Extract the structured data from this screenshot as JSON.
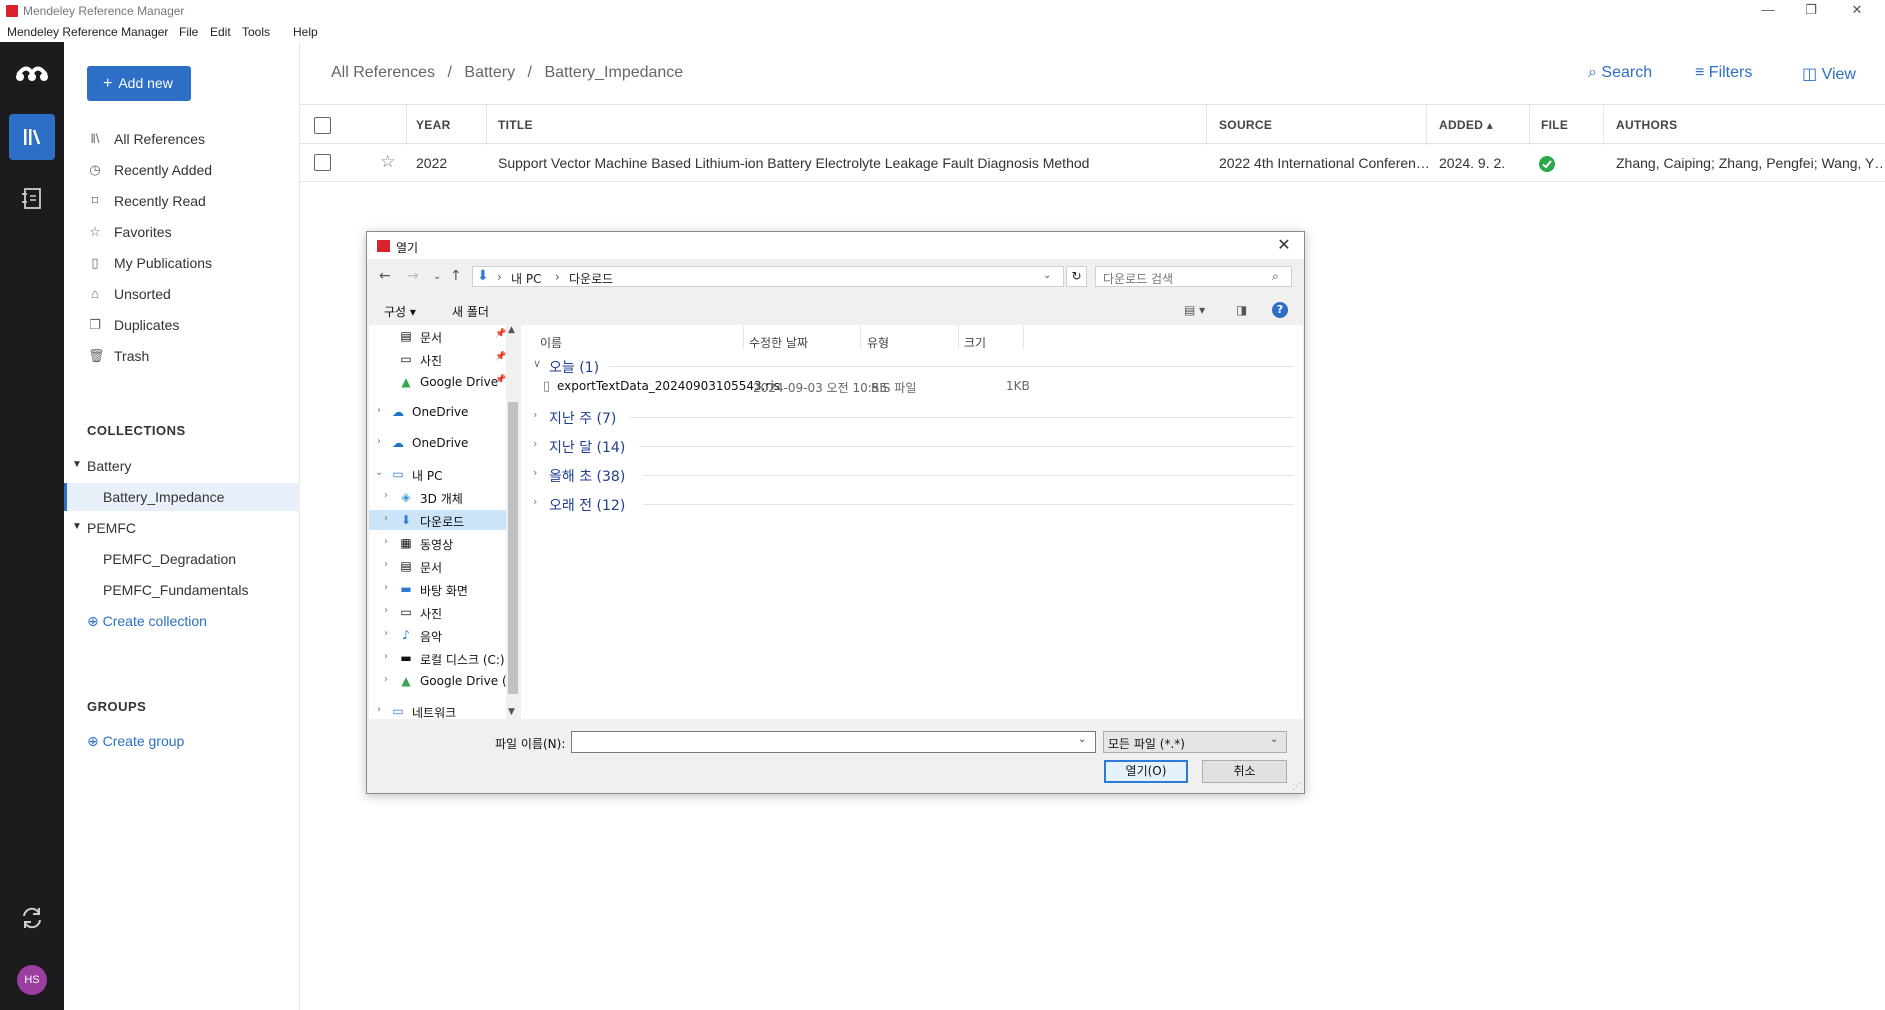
{
  "window": {
    "title": "Mendeley Reference Manager",
    "menu": [
      "Mendeley Reference Manager",
      "File",
      "Edit",
      "Tools",
      "Help"
    ],
    "controls": {
      "minimize": "—",
      "restore": "❐",
      "close": "✕"
    }
  },
  "rail": {
    "avatar_initials": "HS",
    "icons": [
      "mendeley-logo-icon",
      "library-icon",
      "notebook-icon",
      "sync-icon"
    ]
  },
  "sidebar": {
    "add_new_label": "Add new",
    "nav_items": [
      {
        "label": "All References",
        "icon": "library-icon"
      },
      {
        "label": "Recently Added",
        "icon": "clock-icon"
      },
      {
        "label": "Recently Read",
        "icon": "bookmark-icon"
      },
      {
        "label": "Favorites",
        "icon": "star-icon"
      },
      {
        "label": "My Publications",
        "icon": "document-icon"
      },
      {
        "label": "Unsorted",
        "icon": "inbox-icon"
      },
      {
        "label": "Duplicates",
        "icon": "duplicate-icon"
      },
      {
        "label": "Trash",
        "icon": "trash-icon"
      }
    ],
    "collections_heading": "COLLECTIONS",
    "collections": [
      {
        "label": "Battery",
        "expanded": true,
        "level": 0
      },
      {
        "label": "Battery_Impedance",
        "level": 1,
        "selected": true
      },
      {
        "label": "PEMFC",
        "expanded": true,
        "level": 0
      },
      {
        "label": "PEMFC_Degradation",
        "level": 1
      },
      {
        "label": "PEMFC_Fundamentals",
        "level": 1
      }
    ],
    "create_collection_label": "Create collection",
    "groups_heading": "GROUPS",
    "create_group_label": "Create group"
  },
  "main": {
    "breadcrumb": [
      "All References",
      "Battery",
      "Battery_Impedance"
    ],
    "breadcrumb_sep": "/",
    "actions": {
      "search": "Search",
      "filters": "Filters",
      "view": "View"
    },
    "columns": [
      "YEAR",
      "TITLE",
      "SOURCE",
      "ADDED ▴",
      "FILE",
      "AUTHORS"
    ],
    "rows": [
      {
        "year": "2022",
        "title": "Support Vector Machine Based Lithium-ion Battery Electrolyte Leakage Fault Diagnosis Method",
        "source": "2022 4th International Conferen…",
        "added": "2024. 9. 2.",
        "file_status": "available",
        "authors": "Zhang, Caiping; Zhang, Pengfei; Wang, Y…"
      }
    ]
  },
  "dialog": {
    "title": "열기",
    "path": [
      "내 PC",
      "다운로드"
    ],
    "search_placeholder": "다운로드 검색",
    "organize_label": "구성 ▾",
    "new_folder_label": "새 폴더",
    "tree": [
      {
        "label": "문서",
        "icon": "document-icon",
        "pinned": true,
        "indent": 1
      },
      {
        "label": "사진",
        "icon": "pictures-icon",
        "pinned": true,
        "indent": 1
      },
      {
        "label": "Google Drive",
        "icon": "google-drive-icon",
        "pinned": true,
        "indent": 1
      },
      {
        "label": "OneDrive",
        "icon": "onedrive-icon",
        "chevron": "›",
        "indent": 0
      },
      {
        "label": "OneDrive",
        "icon": "onedrive-icon",
        "chevron": "›",
        "indent": 0
      },
      {
        "label": "내 PC",
        "icon": "computer-icon",
        "chevron": "⌄",
        "indent": 0
      },
      {
        "label": "3D 개체",
        "icon": "cube-icon",
        "chevron": "›",
        "indent": 1
      },
      {
        "label": "다운로드",
        "icon": "download-icon",
        "chevron": "›",
        "indent": 1,
        "selected": true
      },
      {
        "label": "동영상",
        "icon": "video-icon",
        "chevron": "›",
        "indent": 1
      },
      {
        "label": "문서",
        "icon": "document-icon",
        "chevron": "›",
        "indent": 1
      },
      {
        "label": "바탕 화면",
        "icon": "desktop-icon",
        "chevron": "›",
        "indent": 1
      },
      {
        "label": "사진",
        "icon": "pictures-icon",
        "chevron": "›",
        "indent": 1
      },
      {
        "label": "음악",
        "icon": "music-icon",
        "chevron": "›",
        "indent": 1
      },
      {
        "label": "로컬 디스크 (C:)",
        "icon": "drive-icon",
        "chevron": "›",
        "indent": 1
      },
      {
        "label": "Google Drive (G",
        "icon": "google-drive-icon",
        "chevron": "›",
        "indent": 1
      },
      {
        "label": "네트워크",
        "icon": "network-icon",
        "chevron": "›",
        "indent": 0
      }
    ],
    "file_columns": [
      "이름",
      "수정한 날짜",
      "유형",
      "크기"
    ],
    "groups": [
      {
        "label": "오늘 (1)",
        "expanded": true
      },
      {
        "label": "지난 주 (7)"
      },
      {
        "label": "지난 달 (14)"
      },
      {
        "label": "올해 초 (38)"
      },
      {
        "label": "오래 전 (12)"
      }
    ],
    "files": [
      {
        "name": "exportTextData_20240903105543.ris",
        "modified": "2024-09-03 오전 10:55",
        "type": "RIS 파일",
        "size": "1KB"
      }
    ],
    "filename_label": "파일 이름(N):",
    "filename_value": "",
    "filetype_value": "모든 파일 (*.*)",
    "open_label": "열기(O)",
    "cancel_label": "취소"
  },
  "colors": {
    "accent": "#2d6fc7",
    "rail": "#1c1c1e",
    "brand_red": "#d8232a",
    "file_ok": "#2aa84a"
  }
}
